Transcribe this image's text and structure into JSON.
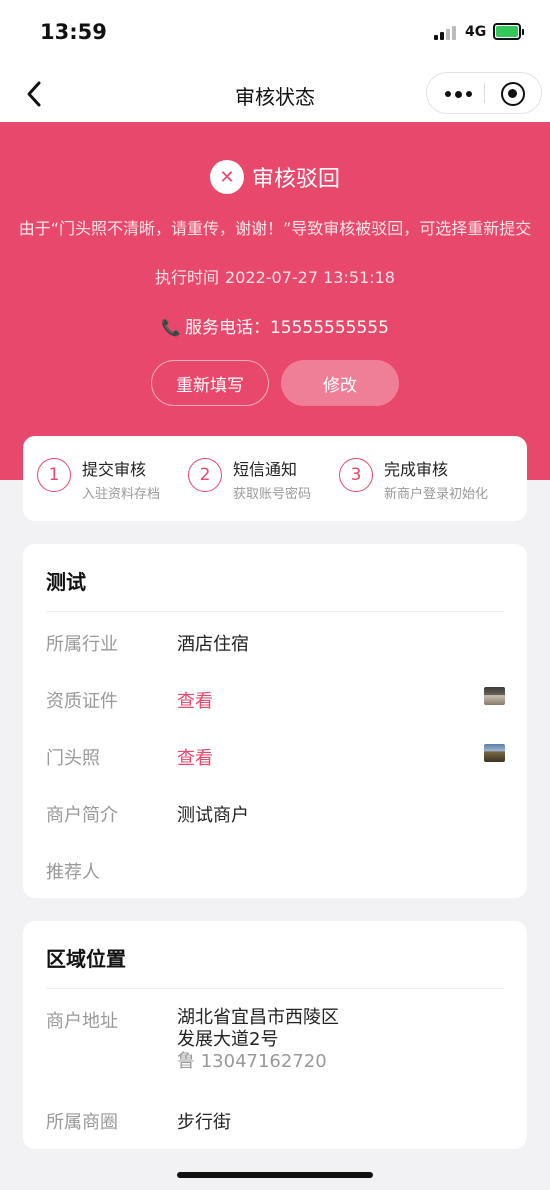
{
  "status_bar": {
    "time": "13:59",
    "network": "4G"
  },
  "nav": {
    "title": "审核状态"
  },
  "hero": {
    "status": "审核驳回",
    "reason": "由于“门头照不清晰，请重传，谢谢！”导致审核被驳回，可选择重新提交",
    "exec_time_label": "执行时间",
    "exec_time_value": "2022-07-27 13:51:18",
    "phone_label": "服务电话：",
    "phone_number": "15555555555",
    "refill_button": "重新填写",
    "edit_button": "修改",
    "accent_color": "#e8486b"
  },
  "steps": [
    {
      "num": "1",
      "title": "提交审核",
      "sub": "入驻资料存档"
    },
    {
      "num": "2",
      "title": "短信通知",
      "sub": "获取账号密码"
    },
    {
      "num": "3",
      "title": "完成审核",
      "sub": "新商户登录初始化"
    }
  ],
  "merchant": {
    "name": "测试",
    "rows": [
      {
        "label": "所属行业",
        "value": "酒店住宿"
      },
      {
        "label": "资质证件",
        "value": "查看"
      },
      {
        "label": "门头照",
        "value": "查看"
      },
      {
        "label": "商户简介",
        "value": "测试商户"
      },
      {
        "label": "推荐人",
        "value": ""
      }
    ]
  },
  "location": {
    "title": "区域位置",
    "address_label": "商户地址",
    "address_line1": "湖北省宜昌市西陵区",
    "address_line2": "发展大道2号",
    "address_tel": "鲁 13047162720",
    "district_label": "所属商圈",
    "district_value": "步行街"
  }
}
